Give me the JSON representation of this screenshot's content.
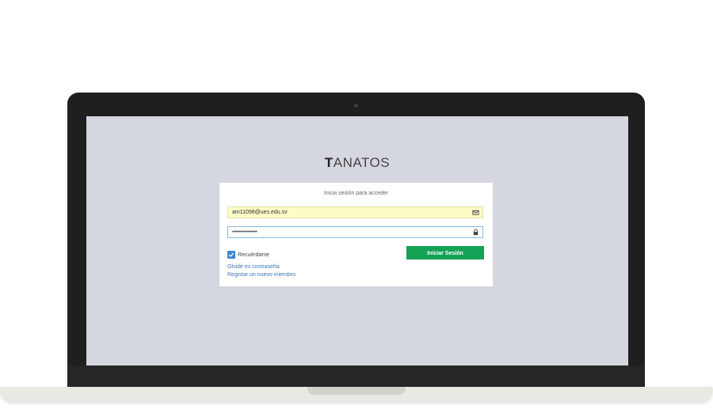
{
  "app": {
    "logo_initial": "T",
    "logo_rest": "ANATOS"
  },
  "login": {
    "subtitle": "Inicia sesión para acceder",
    "email_value": "am11098@ues.edu.sv",
    "password_value": "••••••••••••••••",
    "remember_label": "Recuérdame",
    "remember_checked": true,
    "submit_label": "Iniciar Sesión",
    "forgot_link": "Olvidé mi contraseña",
    "register_link": "Registar un nuevo miembro"
  },
  "icons": {
    "email": "envelope-icon",
    "password": "lock-icon",
    "checkbox": "check-icon"
  },
  "colors": {
    "screen_bg": "#d4d7df",
    "button": "#14a257",
    "link": "#3a78b8",
    "autofill": "#fbfbc6",
    "checkbox": "#3a87d0"
  }
}
